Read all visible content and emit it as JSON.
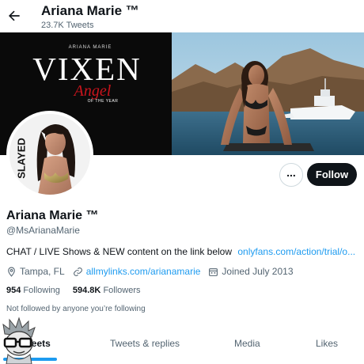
{
  "header": {
    "title": "Ariana Marie ™",
    "tweet_count": "23.7K Tweets",
    "back_icon": "arrow-left-icon"
  },
  "banner": {
    "top_text": "ARIANA MARIE",
    "brand": "VIXEN",
    "award_script": "Angel",
    "award_sub": "OF THE YEAR"
  },
  "avatar": {
    "overlay_text": "SLAYED"
  },
  "actions": {
    "more_icon": "more-horizontal-icon",
    "follow_label": "Follow"
  },
  "profile": {
    "name": "Ariana Marie ™",
    "handle": "@MsArianaMarie",
    "bio_text": "CHAT / LIVE Shows & NEW content on the link below",
    "bio_link": "onlyfans.com/action/trial/o..."
  },
  "meta": {
    "location": "Tampa, FL",
    "website": "allmylinks.com/arianamarie",
    "joined": "Joined July 2013"
  },
  "counts": {
    "following_num": "954",
    "following_label": "Following",
    "followers_num": "594.8K",
    "followers_label": "Followers"
  },
  "not_followed": "Not followed by anyone you’re following",
  "tabs": {
    "tweets": "Tweets",
    "replies": "Tweets & replies",
    "media": "Media",
    "likes": "Likes"
  },
  "colors": {
    "accent": "#1d9bf0",
    "text": "#0f1419",
    "muted": "#536471",
    "vixen_red": "#c8141c"
  }
}
